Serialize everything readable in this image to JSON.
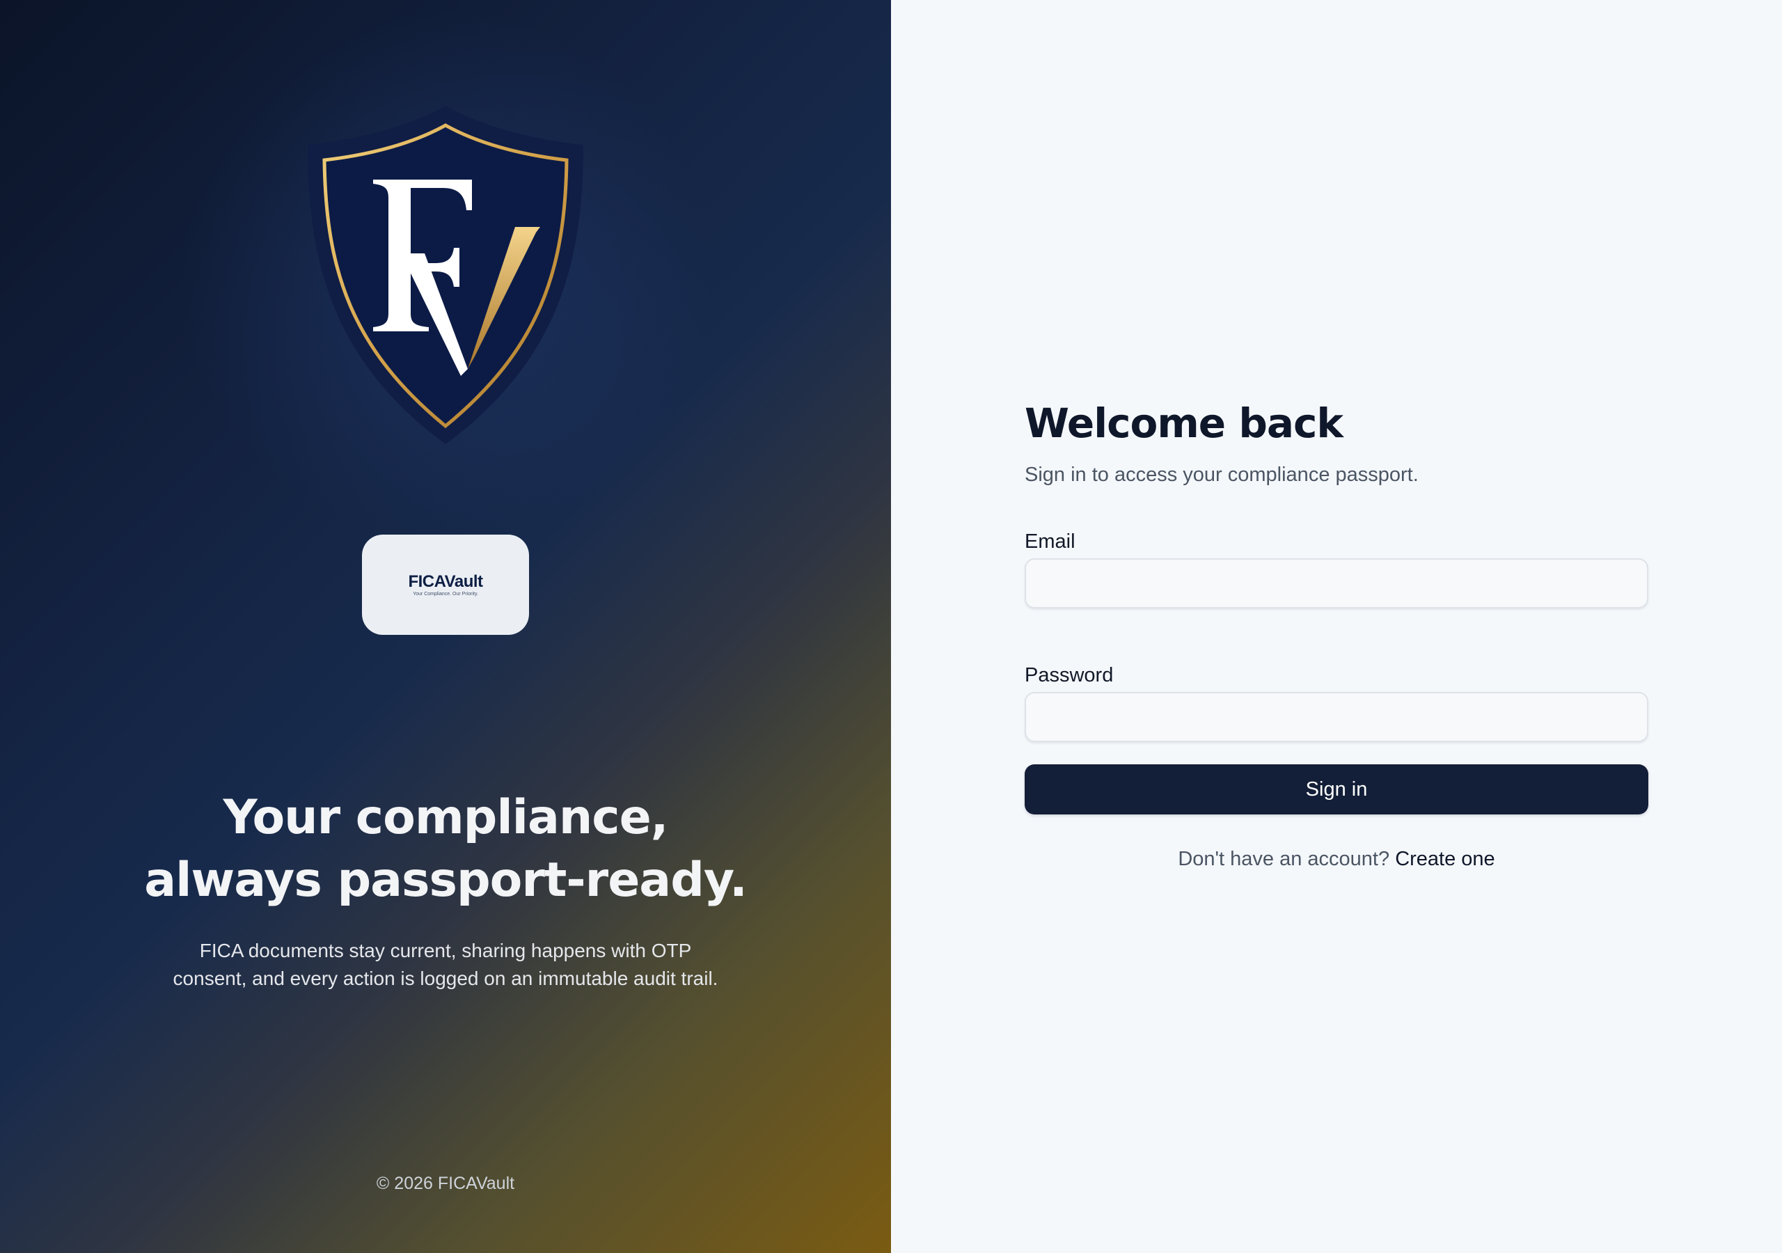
{
  "brand": {
    "logo_icon": "shield-fv-monogram-icon",
    "wordmark": "FICAVault",
    "wordmark_tagline": "Your Compliance. Our Priority.",
    "headline_line1": "Your compliance,",
    "headline_line2": "always passport-ready.",
    "description": "FICA documents stay current, sharing happens with OTP consent, and every action is logged on an immutable audit trail.",
    "copyright": "© 2026 FICAVault",
    "colors": {
      "navy": "#0e1f44",
      "gold": "#c9a04e",
      "panel_gradient_start": "#0b1428",
      "panel_gradient_end": "#7a5b12"
    }
  },
  "login": {
    "title": "Welcome back",
    "subtitle": "Sign in to access your compliance passport.",
    "email_label": "Email",
    "email_value": "",
    "password_label": "Password",
    "password_value": "",
    "submit_label": "Sign in",
    "signup_prompt": "Don't have an account?",
    "signup_link": "Create one",
    "colors": {
      "background": "#f5f8fb",
      "button": "#131f38",
      "title": "#0f172a"
    }
  }
}
